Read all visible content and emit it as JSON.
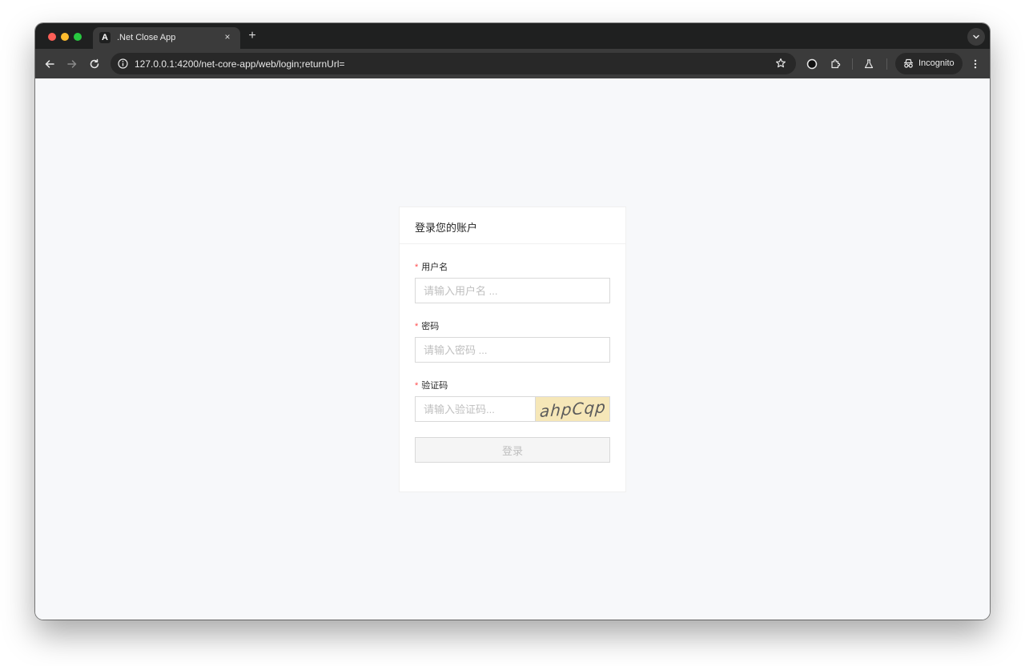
{
  "browser": {
    "tab_title": ".Net Close App",
    "tab_favicon_letter": "A",
    "url": "127.0.0.1:4200/net-core-app/web/login;returnUrl=",
    "incognito_label": "Incognito",
    "new_tab_glyph": "+",
    "close_glyph": "×"
  },
  "login": {
    "title": "登录您的账户",
    "username": {
      "label": "用户名",
      "required_mark": "*",
      "placeholder": "请输入用户名 ..."
    },
    "password": {
      "label": "密码",
      "required_mark": "*",
      "placeholder": "请输入密码 ..."
    },
    "captcha": {
      "label": "验证码",
      "required_mark": "*",
      "placeholder": "请输入验证码...",
      "code": "ahpCqp"
    },
    "submit_label": "登录"
  }
}
